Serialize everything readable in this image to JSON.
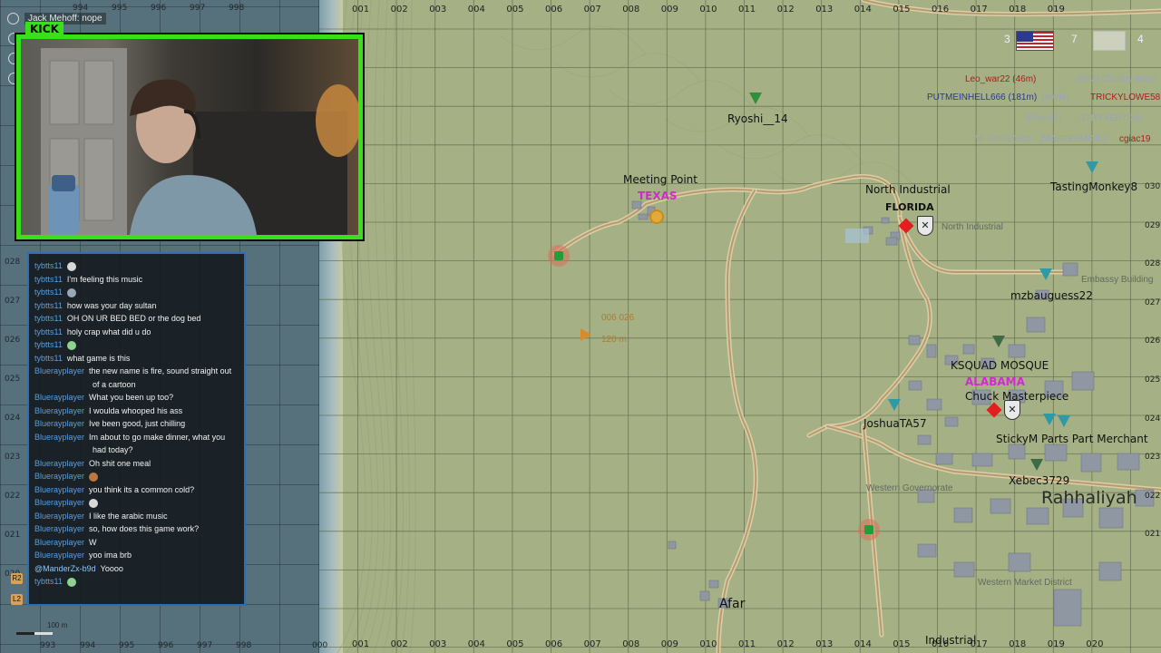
{
  "stream": {
    "title": "Jack Mehoff: nope",
    "platform_badge": "KICK"
  },
  "left_map": {
    "grid_top": [
      "994",
      "995",
      "996",
      "997",
      "998"
    ],
    "grid_bottom": [
      "993",
      "994",
      "995",
      "996",
      "997",
      "998",
      "000"
    ],
    "grid_side": [
      "028",
      "027",
      "026",
      "025",
      "024",
      "023",
      "022",
      "021",
      "020"
    ],
    "scale_label": "100 m",
    "buttons": [
      "R2",
      "L2"
    ]
  },
  "chat": {
    "messages": [
      {
        "user": "tybtts11",
        "text": "",
        "emote": "emote-hand"
      },
      {
        "user": "tybtts11",
        "text": "I'm feeling this music",
        "emote": ""
      },
      {
        "user": "tybtts11",
        "text": "",
        "emote": "emote-guitar"
      },
      {
        "user": "tybtts11",
        "text": "how was your day sultan",
        "emote": ""
      },
      {
        "user": "tybtts11",
        "text": "OH ON UR BED BED or the dog bed",
        "emote": ""
      },
      {
        "user": "tybtts11",
        "text": "holy crap what did u do",
        "emote": ""
      },
      {
        "user": "tybtts11",
        "text": "",
        "emote": "emote-face"
      },
      {
        "user": "tybtts11",
        "text": "what game is this",
        "emote": ""
      },
      {
        "user": "Bluerayplayer",
        "text": "the new name is fire, sound straight out of a cartoon",
        "emote": ""
      },
      {
        "user": "Bluerayplayer",
        "text": "What you been up too?",
        "emote": ""
      },
      {
        "user": "Bluerayplayer",
        "text": "I woulda whooped his ass",
        "emote": ""
      },
      {
        "user": "Bluerayplayer",
        "text": "Ive been good, just chilling",
        "emote": ""
      },
      {
        "user": "Bluerayplayer",
        "text": "Im about to go make dinner, what you had today?",
        "emote": ""
      },
      {
        "user": "Bluerayplayer",
        "text": "Oh shit one meal",
        "emote": ""
      },
      {
        "user": "Bluerayplayer",
        "text": "",
        "emote": "emote-box"
      },
      {
        "user": "Bluerayplayer",
        "text": "you think its a common cold?",
        "emote": ""
      },
      {
        "user": "Bluerayplayer",
        "text": "",
        "emote": "emote-hand"
      },
      {
        "user": "Bluerayplayer",
        "text": "I like the arabic music",
        "emote": ""
      },
      {
        "user": "Bluerayplayer",
        "text": "so, how does this game work?",
        "emote": ""
      },
      {
        "user": "Bluerayplayer",
        "text": "W",
        "emote": ""
      },
      {
        "user": "Bluerayplayer",
        "text": "yoo ima brb",
        "emote": ""
      },
      {
        "user": "@ManderZx-b9d",
        "text": "Yoooo",
        "emote": ""
      },
      {
        "user": "tybtts11",
        "text": "",
        "emote": "emote-face"
      }
    ]
  },
  "map": {
    "grid_top": [
      "001",
      "002",
      "003",
      "004",
      "005",
      "006",
      "007",
      "008",
      "009",
      "010",
      "011",
      "012",
      "013",
      "014",
      "015",
      "016",
      "017",
      "018",
      "019"
    ],
    "grid_bottom": [
      "001",
      "002",
      "003",
      "004",
      "005",
      "006",
      "007",
      "008",
      "009",
      "010",
      "011",
      "012",
      "013",
      "014",
      "015",
      "016",
      "017",
      "018",
      "019",
      "020"
    ],
    "grid_right": [
      "030",
      "029",
      "028",
      "027",
      "026",
      "025",
      "024",
      "023",
      "022",
      "021"
    ],
    "labels": {
      "meeting_point": "Meeting Point",
      "texas": "TEXAS",
      "north_industrial": "North Industrial",
      "florida": "FLORIDA",
      "north_industrial_small": "North Industrial",
      "alabama": "ALABAMA",
      "ksqu_mosque": "KSQUAD MOSQUE",
      "masterpiece": "Chuck Masterpiece",
      "stickym_parts": "StickyM Parts Part Merchant",
      "rahhaliyah": "Rahhaliyah",
      "afar": "Afar",
      "industrial": "Industrial",
      "western_governorate": "Western Governorate",
      "western_market": "Western Market District",
      "embassy": "Embassy Building",
      "waypoint_coords": "006 026",
      "waypoint_distance": "120 m"
    },
    "players": {
      "ryoshi": "Ryoshi__14",
      "tasting": "TastingMonkey8",
      "mzbaug": "mzbauguess22",
      "joshua": "JoshuaTA57",
      "xebec": "Xebec3729"
    },
    "player_list": {
      "row1a": "Leo_war22 (46m)",
      "row1b": "(RPJ)",
      "row1c": "Chubby Body",
      "row2a": "PUTMEINHELL666 (181m)",
      "row2b": "(AWM)",
      "row2c": "TRICKYLOWE58",
      "row3a": "(Friend7)",
      "row3b": "STRYKER70n5",
      "row4a": "Mr Ponia (5m)",
      "row4b": "(MASTERMIND)",
      "row4c": "cgiac19"
    },
    "hud_numbers": [
      "3",
      "7",
      "4"
    ]
  },
  "colors": {
    "chat_border": "#2b6fb0",
    "cam_border": "#37e01a",
    "state_label": "#d12ad1",
    "map_bg": "#a6b085"
  }
}
